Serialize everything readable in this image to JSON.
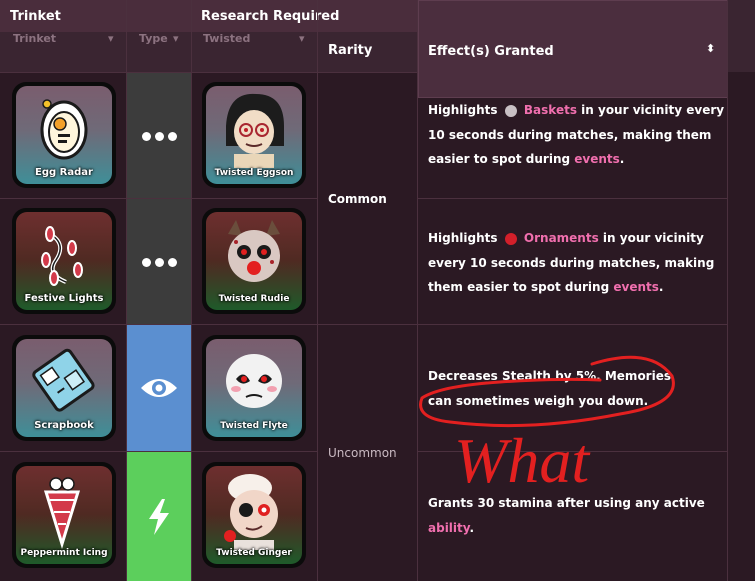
{
  "header": {
    "trinket": "Trinket",
    "research_required": "Research Required",
    "trinket_sub": "Trinket",
    "type_sub": "Type",
    "twisted_sub": "Twisted",
    "rarity": "Rarity",
    "effects": "Effect(s) Granted"
  },
  "rows": [
    {
      "trinket": "Egg Radar",
      "twisted": "Twisted Eggson",
      "effect": {
        "pre": "Highlights",
        "link": "Baskets",
        "post": "in your vicinity every 10 seconds during matches, making them easier to spot during",
        "link2": "events",
        "end": "."
      }
    },
    {
      "trinket": "Festive Lights",
      "twisted": "Twisted Rudie",
      "effect": {
        "pre": "Highlights",
        "link": "Ornaments",
        "post": "in your vicinity every 10 seconds during matches, making them easier to spot during",
        "link2": "events",
        "end": "."
      }
    },
    {
      "trinket": "Scrapbook",
      "twisted": "Twisted Flyte",
      "effect": {
        "text": "Decreases Stealth by 5%. Memories can sometimes weigh you down."
      }
    },
    {
      "trinket": "Peppermint Icing",
      "twisted": "Twisted Ginger",
      "effect": {
        "pre": "Grants 30 stamina after using any active",
        "link": "ability",
        "end": "."
      }
    }
  ],
  "rarity": {
    "common": "Common",
    "uncommon": "Uncommon"
  },
  "annotation": {
    "text": "What"
  },
  "colors": {
    "type_blue": "#5b8fd0",
    "type_green": "#5ccf5c",
    "type_dark": "#3c3c3c",
    "link_pink": "#f06fae",
    "annotation_red": "#e32020"
  }
}
